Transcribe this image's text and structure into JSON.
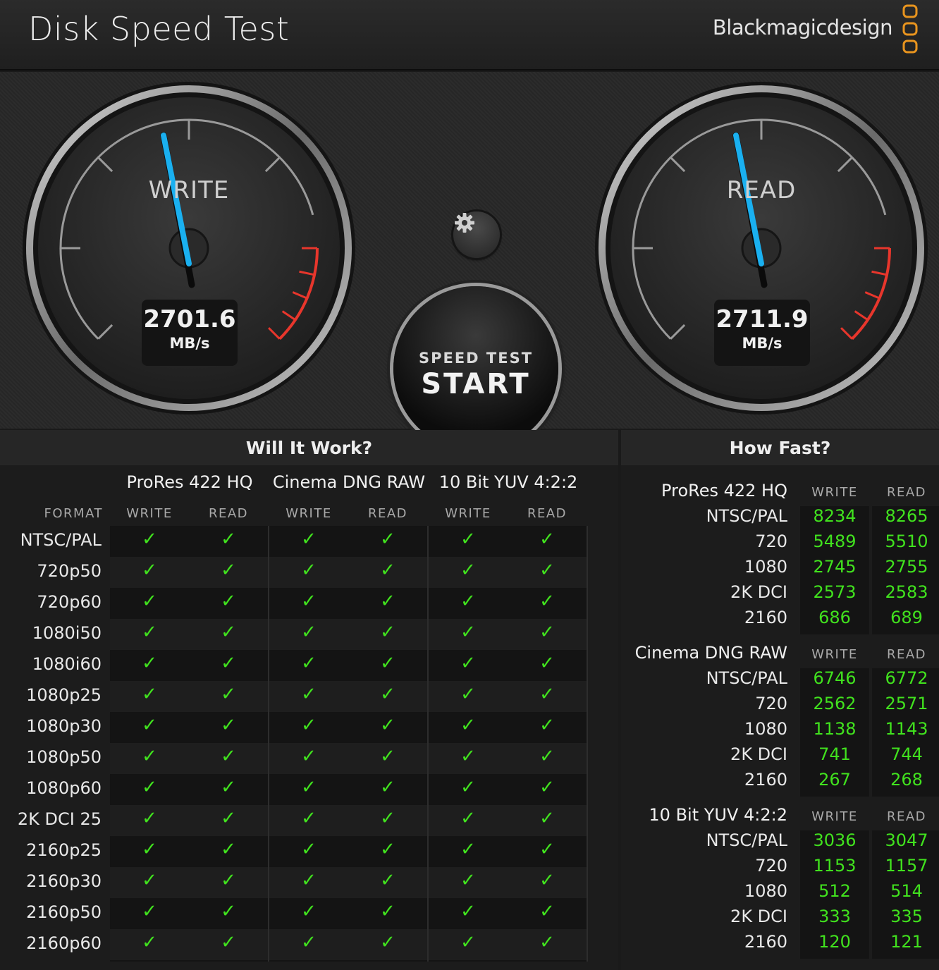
{
  "app": {
    "title": "Disk Speed Test",
    "brand": "Blackmagicdesign"
  },
  "gauges": {
    "write": {
      "label": "WRITE",
      "value": "2701.6",
      "unit": "MB/s"
    },
    "read": {
      "label": "READ",
      "value": "2711.9",
      "unit": "MB/s"
    }
  },
  "controls": {
    "settings_icon": "gear-icon",
    "start_small": "SPEED TEST",
    "start_big": "START"
  },
  "will_it_work": {
    "title": "Will It Work?",
    "format_label": "FORMAT",
    "groups": [
      {
        "name": "ProRes 422 HQ",
        "write": "WRITE",
        "read": "READ"
      },
      {
        "name": "Cinema DNG RAW",
        "write": "WRITE",
        "read": "READ"
      },
      {
        "name": "10 Bit YUV 4:2:2",
        "write": "WRITE",
        "read": "READ"
      }
    ],
    "check_symbol": "✓",
    "formats": [
      "NTSC/PAL",
      "720p50",
      "720p60",
      "1080i50",
      "1080i60",
      "1080p25",
      "1080p30",
      "1080p50",
      "1080p60",
      "2K DCI 25",
      "2160p25",
      "2160p30",
      "2160p50",
      "2160p60"
    ],
    "results": [
      [
        true,
        true,
        true,
        true,
        true,
        true
      ],
      [
        true,
        true,
        true,
        true,
        true,
        true
      ],
      [
        true,
        true,
        true,
        true,
        true,
        true
      ],
      [
        true,
        true,
        true,
        true,
        true,
        true
      ],
      [
        true,
        true,
        true,
        true,
        true,
        true
      ],
      [
        true,
        true,
        true,
        true,
        true,
        true
      ],
      [
        true,
        true,
        true,
        true,
        true,
        true
      ],
      [
        true,
        true,
        true,
        true,
        true,
        true
      ],
      [
        true,
        true,
        true,
        true,
        true,
        true
      ],
      [
        true,
        true,
        true,
        true,
        true,
        true
      ],
      [
        true,
        true,
        true,
        true,
        true,
        true
      ],
      [
        true,
        true,
        true,
        true,
        true,
        true
      ],
      [
        true,
        true,
        true,
        true,
        true,
        true
      ],
      [
        true,
        true,
        true,
        true,
        true,
        true
      ]
    ]
  },
  "how_fast": {
    "title": "How Fast?",
    "groups": [
      {
        "name": "ProRes 422 HQ",
        "write": "WRITE",
        "read": "READ",
        "rows": [
          {
            "label": "NTSC/PAL",
            "w": "8234",
            "r": "8265"
          },
          {
            "label": "720",
            "w": "5489",
            "r": "5510"
          },
          {
            "label": "1080",
            "w": "2745",
            "r": "2755"
          },
          {
            "label": "2K DCI",
            "w": "2573",
            "r": "2583"
          },
          {
            "label": "2160",
            "w": "686",
            "r": "689"
          }
        ]
      },
      {
        "name": "Cinema DNG RAW",
        "write": "WRITE",
        "read": "READ",
        "rows": [
          {
            "label": "NTSC/PAL",
            "w": "6746",
            "r": "6772"
          },
          {
            "label": "720",
            "w": "2562",
            "r": "2571"
          },
          {
            "label": "1080",
            "w": "1138",
            "r": "1143"
          },
          {
            "label": "2K DCI",
            "w": "741",
            "r": "744"
          },
          {
            "label": "2160",
            "w": "267",
            "r": "268"
          }
        ]
      },
      {
        "name": "10 Bit YUV 4:2:2",
        "write": "WRITE",
        "read": "READ",
        "rows": [
          {
            "label": "NTSC/PAL",
            "w": "3036",
            "r": "3047"
          },
          {
            "label": "720",
            "w": "1153",
            "r": "1157"
          },
          {
            "label": "1080",
            "w": "512",
            "r": "514"
          },
          {
            "label": "2K DCI",
            "w": "333",
            "r": "335"
          },
          {
            "label": "2160",
            "w": "120",
            "r": "121"
          }
        ]
      }
    ]
  },
  "colors": {
    "accent_green": "#41e21e",
    "needle_blue": "#1ab0f0",
    "redline": "#e8362c",
    "logo_orange": "#e8941e"
  }
}
